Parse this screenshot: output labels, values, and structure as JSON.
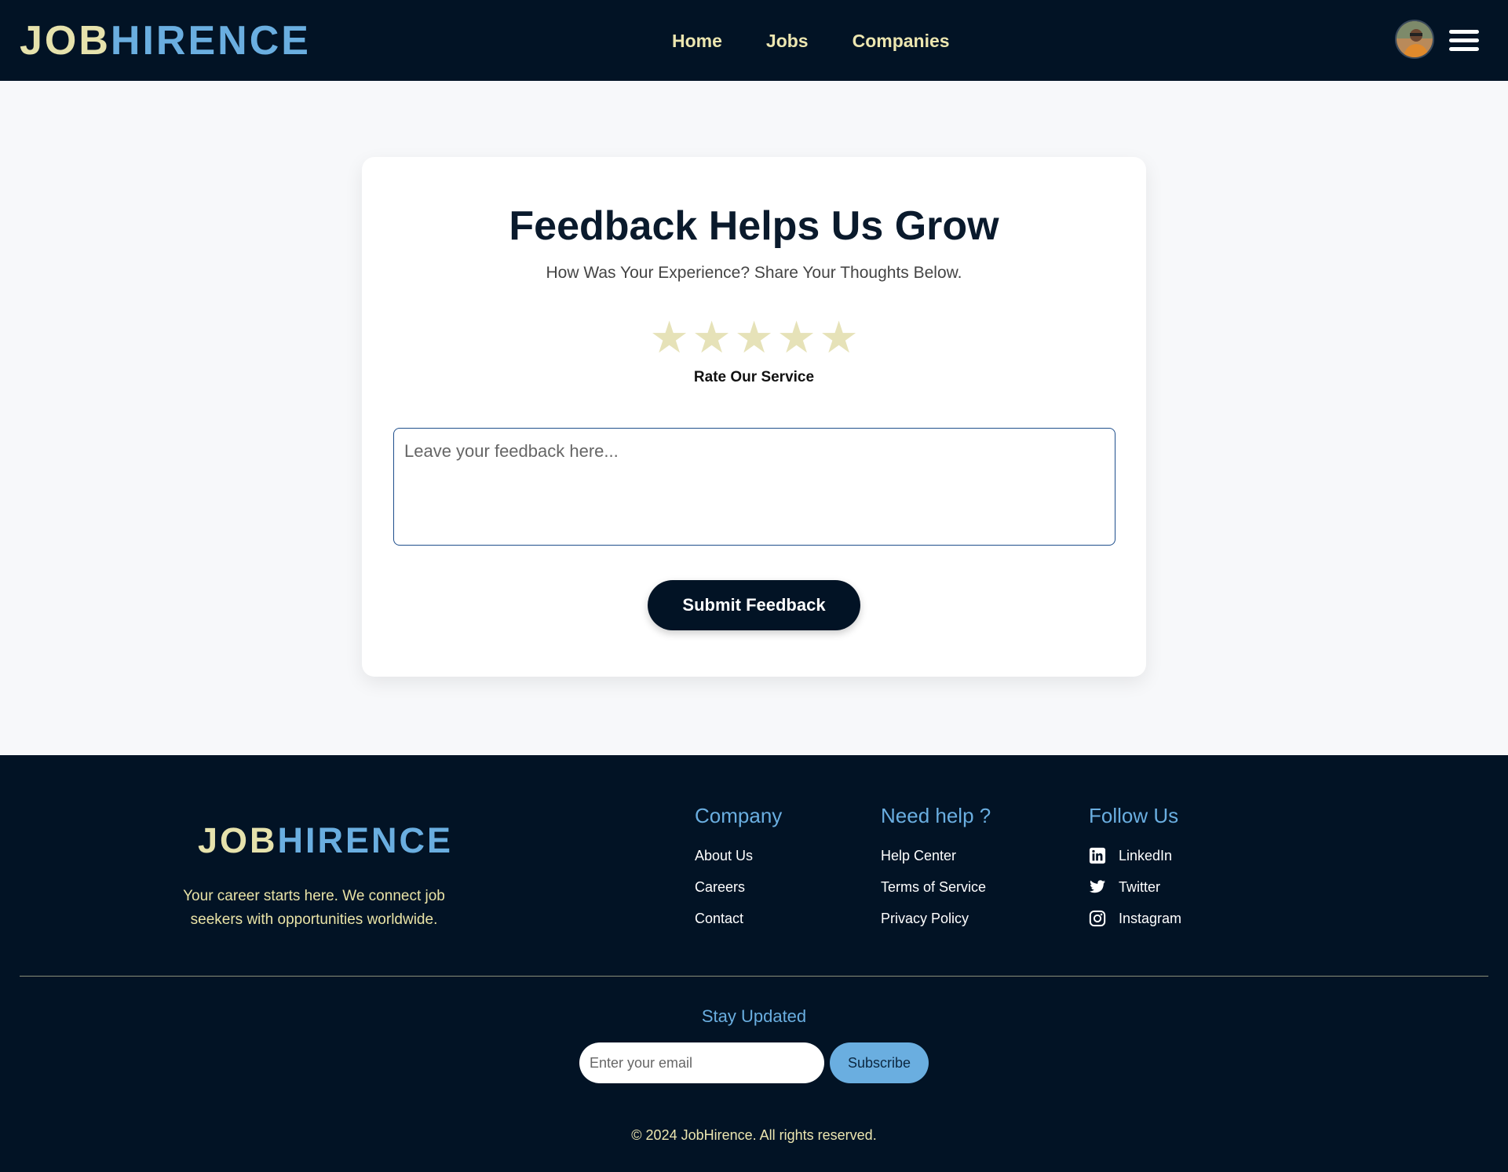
{
  "header": {
    "logo_part1": "JOB",
    "logo_part2": "HIRENCE",
    "nav": [
      {
        "label": "Home"
      },
      {
        "label": "Jobs"
      },
      {
        "label": "Companies"
      }
    ],
    "avatar_icon": "user-avatar",
    "menu_icon": "hamburger-menu-icon"
  },
  "feedback": {
    "title": "Feedback Helps Us Grow",
    "subtitle": "How Was Your Experience? Share Your Thoughts Below.",
    "rating": {
      "max": 5,
      "selected": 0,
      "star_icon": "star-icon",
      "label": "Rate Our Service"
    },
    "textarea_placeholder": "Leave your feedback here...",
    "textarea_value": "",
    "submit_label": "Submit Feedback"
  },
  "footer": {
    "logo_part1": "JOB",
    "logo_part2": "HIRENCE",
    "tagline": "Your career starts here. We connect job seekers with opportunities worldwide.",
    "columns": [
      {
        "title": "Company",
        "links": [
          {
            "label": "About Us"
          },
          {
            "label": "Careers"
          },
          {
            "label": "Contact"
          }
        ]
      },
      {
        "title": "Need help ?",
        "links": [
          {
            "label": "Help Center"
          },
          {
            "label": "Terms of Service"
          },
          {
            "label": "Privacy Policy"
          }
        ]
      },
      {
        "title": "Follow Us",
        "links": [
          {
            "label": "LinkedIn",
            "icon": "linkedin-icon"
          },
          {
            "label": "Twitter",
            "icon": "twitter-icon"
          },
          {
            "label": "Instagram",
            "icon": "instagram-icon"
          }
        ]
      }
    ],
    "newsletter": {
      "title": "Stay Updated",
      "email_placeholder": "Enter your email",
      "email_value": "",
      "button_label": "Subscribe"
    },
    "copyright": "© 2024 JobHirence. All rights reserved."
  },
  "colors": {
    "navy": "#021325",
    "logo_cream": "#e6e2ac",
    "logo_blue": "#6aaee0",
    "star": "#e6e2b8",
    "page_bg": "#f7f8fa"
  }
}
